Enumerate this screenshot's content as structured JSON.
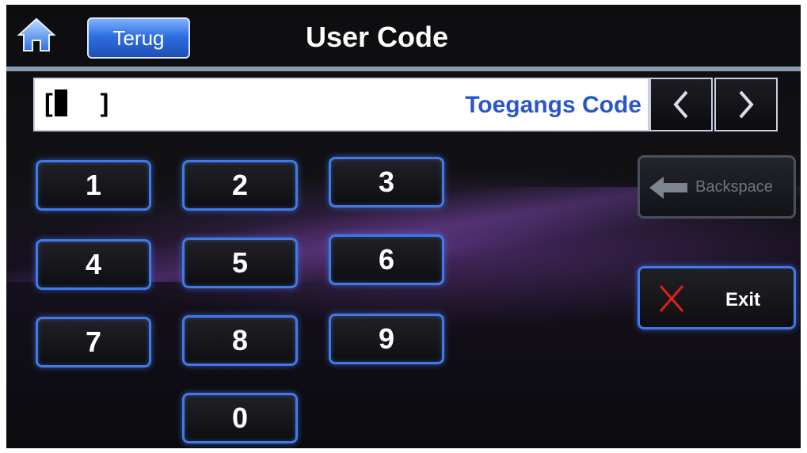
{
  "header": {
    "home_icon": "home-icon",
    "back_label": "Terug",
    "title": "User Code"
  },
  "code_entry": {
    "open_bracket": "[",
    "close_bracket": "]",
    "label": "Toegangs Code",
    "prev_icon": "chevron-left-icon",
    "next_icon": "chevron-right-icon"
  },
  "keypad": {
    "keys": [
      "1",
      "2",
      "3",
      "4",
      "5",
      "6",
      "7",
      "8",
      "9",
      "0"
    ]
  },
  "actions": {
    "backspace_label": "Backspace",
    "backspace_icon": "arrow-left-icon",
    "exit_label": "Exit",
    "exit_icon": "close-icon"
  },
  "colors": {
    "accent_blue": "#3f7ae8",
    "label_blue": "#2a57c8",
    "exit_red": "#e0201c",
    "background": "#0d0d10"
  }
}
